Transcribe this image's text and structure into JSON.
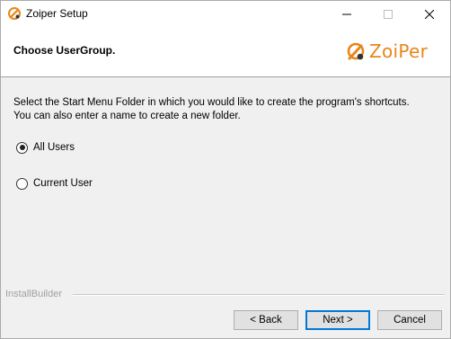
{
  "window": {
    "title": "Zoiper  Setup"
  },
  "header": {
    "title": "Choose UserGroup.",
    "logo_text": "ZoiPer"
  },
  "body": {
    "description_line1": "Select the Start Menu Folder in which you would like to create the program's shortcuts.",
    "description_line2": "You can also enter a name to create a new folder.",
    "options": [
      {
        "label": "All Users",
        "checked": true
      },
      {
        "label": "Current User",
        "checked": false
      }
    ]
  },
  "footer": {
    "brand": "InstallBuilder",
    "back_label": "< Back",
    "next_label": "Next >",
    "cancel_label": "Cancel"
  },
  "colors": {
    "accent": "#0078d7",
    "logo": "#e8861a"
  }
}
